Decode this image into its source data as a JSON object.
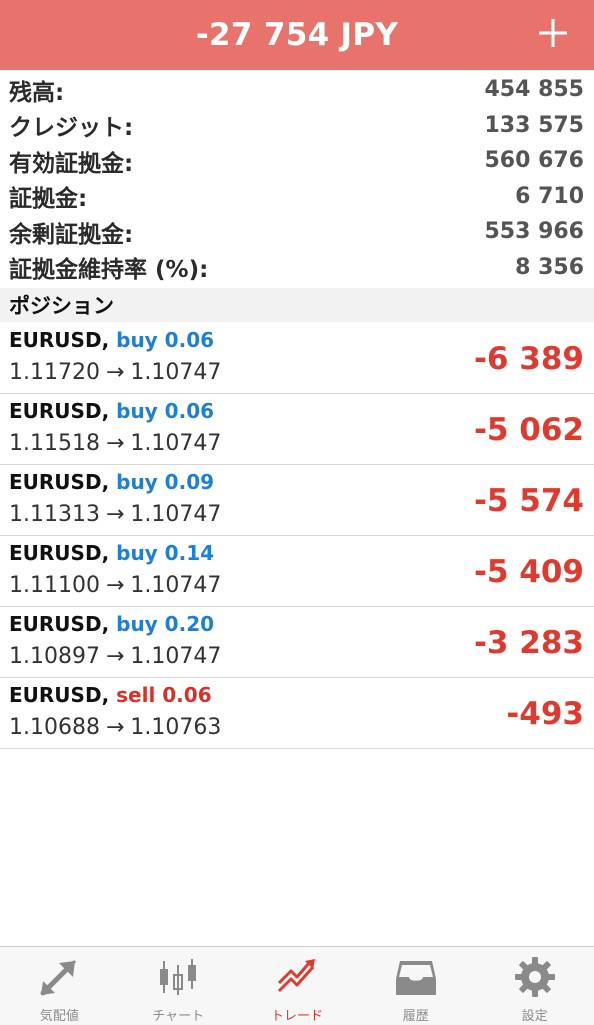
{
  "header": {
    "title": "-27 754 JPY"
  },
  "summary": [
    {
      "label": "残高:",
      "value": "454 855"
    },
    {
      "label": "クレジット:",
      "value": "133 575"
    },
    {
      "label": "有効証拠金:",
      "value": "560 676"
    },
    {
      "label": "証拠金:",
      "value": "6 710"
    },
    {
      "label": "余剰証拠金:",
      "value": "553 966"
    },
    {
      "label": "証拠金維持率 (%):",
      "value": "8 356"
    }
  ],
  "positions_header": "ポジション",
  "positions": [
    {
      "symbol": "EURUSD",
      "side": "buy 0.06",
      "open": "1.11720",
      "current": "1.10747",
      "profit": "-6 389"
    },
    {
      "symbol": "EURUSD",
      "side": "buy 0.06",
      "open": "1.11518",
      "current": "1.10747",
      "profit": "-5 062"
    },
    {
      "symbol": "EURUSD",
      "side": "buy 0.09",
      "open": "1.11313",
      "current": "1.10747",
      "profit": "-5 574"
    },
    {
      "symbol": "EURUSD",
      "side": "buy 0.14",
      "open": "1.11100",
      "current": "1.10747",
      "profit": "-5 409"
    },
    {
      "symbol": "EURUSD",
      "side": "buy 0.20",
      "open": "1.10897",
      "current": "1.10747",
      "profit": "-3 283"
    },
    {
      "symbol": "EURUSD",
      "side": "sell 0.06",
      "open": "1.10688",
      "current": "1.10763",
      "profit": "-493"
    }
  ],
  "tabs": [
    {
      "label": "気配値",
      "icon": "quotes-icon"
    },
    {
      "label": "チャート",
      "icon": "chart-icon"
    },
    {
      "label": "トレード",
      "icon": "trade-icon",
      "active": true
    },
    {
      "label": "履歴",
      "icon": "history-icon"
    },
    {
      "label": "設定",
      "icon": "settings-icon"
    }
  ],
  "colors": {
    "header_bg": "#e8736c",
    "buy": "#1e7fd9",
    "sell": "#d9302a",
    "profit_negative": "#e03a2f",
    "tab_active": "#e03a2f"
  }
}
